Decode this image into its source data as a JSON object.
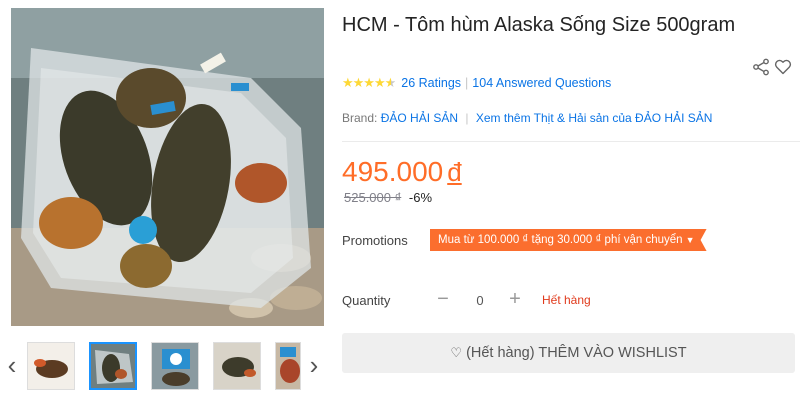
{
  "product": {
    "title": "HCM - Tôm hùm Alaska Sống Size 500gram",
    "rating_stars": "★★★★",
    "rating_half_star": "★",
    "ratings_count_label": "26 Ratings",
    "questions_label": "104 Answered Questions",
    "brand_label": "Brand:",
    "brand_name": "ĐẢO HẢI SẢN",
    "brand_more": "Xem thêm Thịt & Hải sản của ĐẢO HẢI SẢN",
    "price": "495.000",
    "price_currency": "đ",
    "old_price": "525.000 ₫",
    "discount": "-6%"
  },
  "promotions": {
    "label": "Promotions",
    "tag": "Mua từ 100.000 ₫ tặng 30.000 ₫ phí vận chuyển",
    "caret": "▼"
  },
  "quantity": {
    "label": "Quantity",
    "value": "0",
    "minus": "−",
    "plus": "+",
    "status": "Hết hàng"
  },
  "wishlist": {
    "heart": "♡",
    "label": "(Hết hàng) THÊM VÀO WISHLIST"
  },
  "gallery": {
    "prev": "‹",
    "next": "›",
    "active_index": 1
  },
  "colors": {
    "price": "#ff6d28",
    "link": "#0b74e5",
    "promo_bg": "#fb6e2e",
    "star": "#fdd836",
    "out_of_stock": "#e03a1c"
  },
  "icons": [
    "share-icon",
    "heart-icon",
    "chevron-left-icon",
    "chevron-right-icon",
    "caret-down-icon"
  ]
}
